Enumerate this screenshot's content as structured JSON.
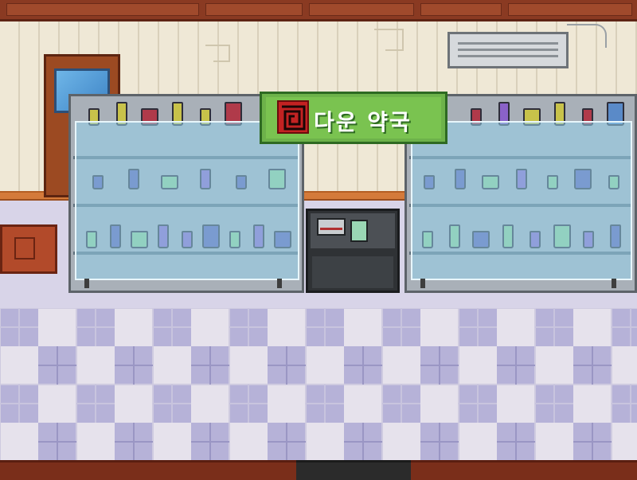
{
  "scene": {
    "type": "pixel-art game interior",
    "location": "pharmacy"
  },
  "sign": {
    "text": "다운 약국",
    "logo_icon": "square-spiral-logo-icon",
    "background_color": "#6db24a",
    "logo_color": "#c32222"
  },
  "colors": {
    "wall": "#efe8d6",
    "beam": "#8a3a22",
    "floor_light": "#e6e2ec",
    "floor_purple": "#b6b2d8",
    "glass": "#96d2eb"
  },
  "shelves": {
    "left": {
      "top_row": [
        "#c8c24a",
        "#c8c24a",
        "#b03a4a",
        "#c8c24a",
        "#c8c24a",
        "#b03a4a"
      ],
      "mid_row": [
        "#5a5ab0",
        "#5a5ab0",
        "#8fd08f",
        "#8a62c8",
        "#5a5ab0",
        "#8fd08f"
      ],
      "low_row": [
        "#8fd08f",
        "#5a5ab0",
        "#8fd08f",
        "#8a62c8",
        "#8a62c8",
        "#5a5ab0",
        "#8fd08f",
        "#8a62c8",
        "#5a5ab0"
      ]
    },
    "right": {
      "top_row": [
        "#b03a4a",
        "#8a62c8",
        "#c8c24a",
        "#c8c24a",
        "#b03a4a",
        "#5a8ac8"
      ],
      "mid_row": [
        "#5a5ab0",
        "#5a5ab0",
        "#8fd08f",
        "#8a62c8",
        "#8fd08f",
        "#5a5ab0",
        "#8fd08f"
      ],
      "low_row": [
        "#8fd08f",
        "#8fd08f",
        "#5a5ab0",
        "#8fd08f",
        "#8a62c8",
        "#8fd08f",
        "#8a62c8",
        "#5a5ab0"
      ]
    }
  }
}
